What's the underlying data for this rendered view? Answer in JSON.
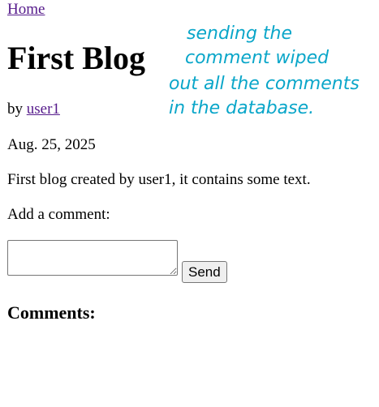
{
  "nav": {
    "home_label": "Home"
  },
  "post": {
    "title": "First Blog",
    "by_prefix": "by ",
    "author": "user1",
    "date": "Aug. 25, 2025",
    "body": "First blog created by user1, it contains some text."
  },
  "comment_form": {
    "label": "Add a comment:",
    "textarea_value": "",
    "send_label": "Send"
  },
  "comments": {
    "heading": "Comments:",
    "items": []
  },
  "annotation": {
    "lines": [
      "sending the",
      "comment wiped",
      "out all the comments",
      "in the database."
    ],
    "color": "#0aa6c9"
  },
  "colors": {
    "link": "#551a8b",
    "text": "#000000",
    "background": "#ffffff"
  }
}
